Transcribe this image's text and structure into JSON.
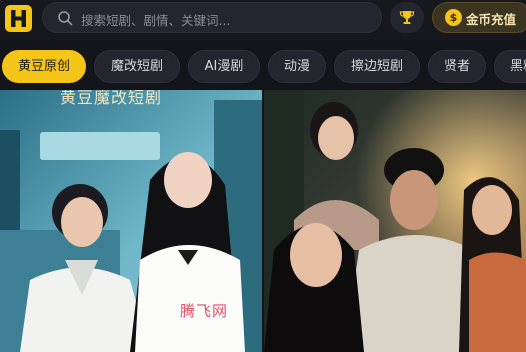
{
  "header": {
    "logo_letter": "H",
    "search": {
      "placeholder": "搜索短剧、剧情、关键词..."
    },
    "coin_button": {
      "label": "金币充值",
      "coin_symbol": "$"
    }
  },
  "categories": [
    {
      "label": "黄豆原创",
      "active": true
    },
    {
      "label": "魔改短剧",
      "active": false
    },
    {
      "label": "AI漫剧",
      "active": false
    },
    {
      "label": "动漫",
      "active": false
    },
    {
      "label": "擦边短剧",
      "active": false
    },
    {
      "label": "贤者",
      "active": false
    },
    {
      "label": "黑料",
      "active": false
    }
  ],
  "posters": [
    {
      "title": "黄豆魔改短剧",
      "watermark": "腾飞网"
    },
    {
      "title": ""
    }
  ],
  "colors": {
    "accent": "#f5c518",
    "background": "#13151b"
  }
}
